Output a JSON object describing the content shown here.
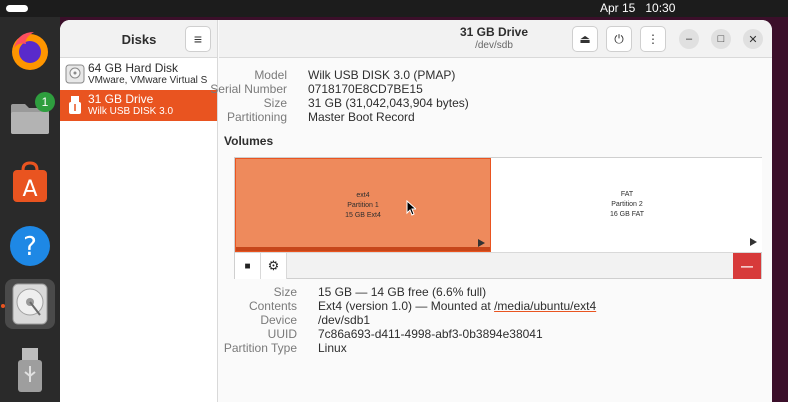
{
  "topbar": {
    "date": "Apr 15",
    "time": "10:30"
  },
  "dock": {
    "items": [
      {
        "name": "firefox",
        "badge": ""
      },
      {
        "name": "files",
        "badge": "1"
      },
      {
        "name": "app-center",
        "badge": ""
      },
      {
        "name": "help",
        "badge": ""
      },
      {
        "name": "disks",
        "badge": ""
      },
      {
        "name": "usb-drive",
        "badge": ""
      }
    ]
  },
  "sidebar": {
    "title": "Disks",
    "disks": [
      {
        "name": "64 GB Hard Disk",
        "model": "VMware, VMware Virtual S"
      },
      {
        "name": "31 GB Drive",
        "model": "Wilk USB DISK 3.0"
      }
    ]
  },
  "header": {
    "title": "31 GB Drive",
    "subtitle": "/dev/sdb"
  },
  "drive_info": {
    "model_label": "Model",
    "model": "Wilk USB DISK 3.0 (PMAP)",
    "serial_label": "Serial Number",
    "serial": "0718170E8CD7BE15",
    "size_label": "Size",
    "size": "31 GB (31,042,043,904 bytes)",
    "partitioning_label": "Partitioning",
    "partitioning": "Master Boot Record"
  },
  "volumes": {
    "title": "Volumes",
    "partitions": [
      {
        "type": "ext4",
        "name": "Partition 1",
        "desc": "15 GB Ext4"
      },
      {
        "type": "FAT",
        "name": "Partition 2",
        "desc": "16 GB FAT"
      }
    ],
    "delete_label": "—"
  },
  "partition_info": {
    "size_label": "Size",
    "size": "15 GB — 14 GB free (6.6% full)",
    "contents_label": "Contents",
    "contents_prefix": "Ext4 (version 1.0) — Mounted at ",
    "mount_point": "/media/ubuntu/ext4",
    "device_label": "Device",
    "device": "/dev/sdb1",
    "uuid_label": "UUID",
    "uuid": "7c86a693-d411-4998-abf3-0b3894e38041",
    "ptype_label": "Partition Type",
    "ptype": "Linux"
  },
  "colors": {
    "accent": "#e95420",
    "partition_selected": "#ee8a5c",
    "delete": "#d73a3a"
  }
}
